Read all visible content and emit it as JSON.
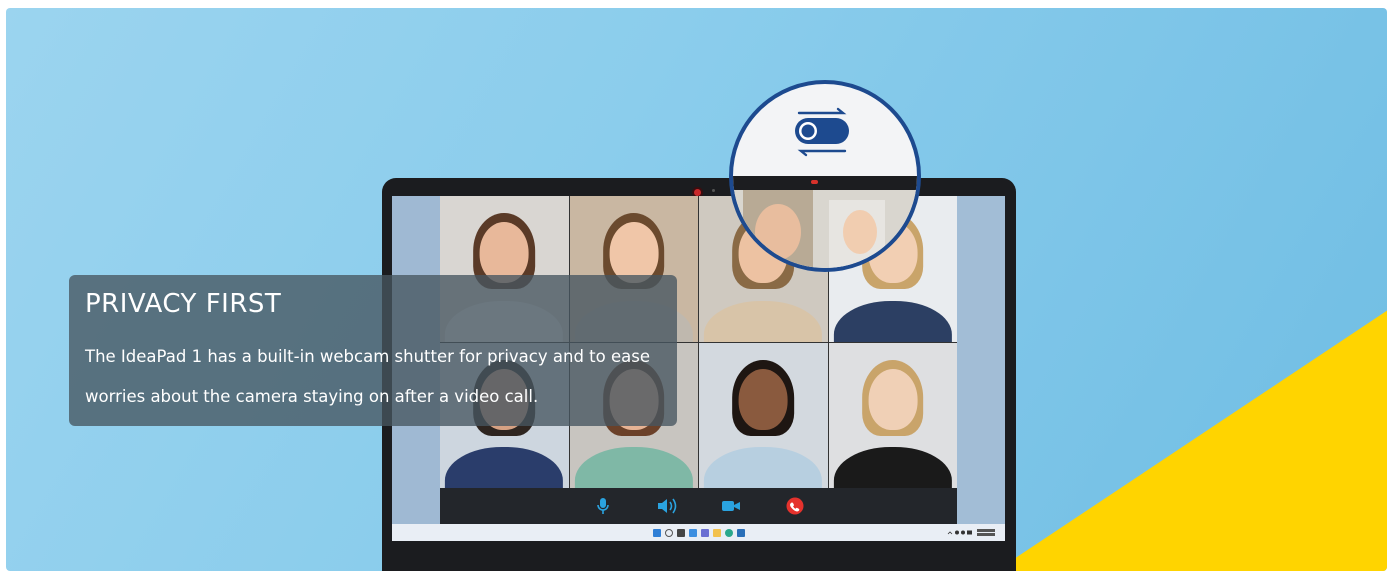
{
  "feature": {
    "title": "PRIVACY FIRST",
    "description": "The IdeaPad 1 has a built-in webcam shutter for privacy and to ease worries about the camera staying on after a video call."
  },
  "colors": {
    "sky": "#8bcdec",
    "accent_yellow": "#ffd400",
    "shutter_blue": "#1d4a8f",
    "end_call_red": "#e5322d",
    "control_blue": "#2aa3e0"
  },
  "icons": {
    "call_controls": [
      "microphone-icon",
      "speaker-icon",
      "video-camera-icon",
      "end-call-icon"
    ],
    "shutter": "webcam-shutter-toggle-icon"
  },
  "participants": [
    {
      "skin": "#e8b89a",
      "hair": "#5a3a27",
      "clothes": "#eeeeee",
      "bg": "#d9d6d2"
    },
    {
      "skin": "#f0c6a8",
      "hair": "#6b4a2e",
      "clothes": "#bfb8ae",
      "bg": "#c9b7a2"
    },
    {
      "skin": "#edc2a2",
      "hair": "#8a6a45",
      "clothes": "#d8c4a8",
      "bg": "#cfc9c0"
    },
    {
      "skin": "#f2cfb3",
      "hair": "#c9a46a",
      "clothes": "#2c3f63",
      "bg": "#e9ecef"
    },
    {
      "skin": "#d6a183",
      "hair": "#2e2520",
      "clothes": "#2a3d6b",
      "bg": "#cdd6df"
    },
    {
      "skin": "#e7b394",
      "hair": "#6b4129",
      "clothes": "#7fb8a6",
      "bg": "#c8c5c0"
    },
    {
      "skin": "#8a5a3e",
      "hair": "#1e1612",
      "clothes": "#b7cfe0",
      "bg": "#d3d9df"
    },
    {
      "skin": "#f0d0b6",
      "hair": "#c9a46a",
      "clothes": "#1a1a1a",
      "bg": "#dedfe1"
    }
  ]
}
